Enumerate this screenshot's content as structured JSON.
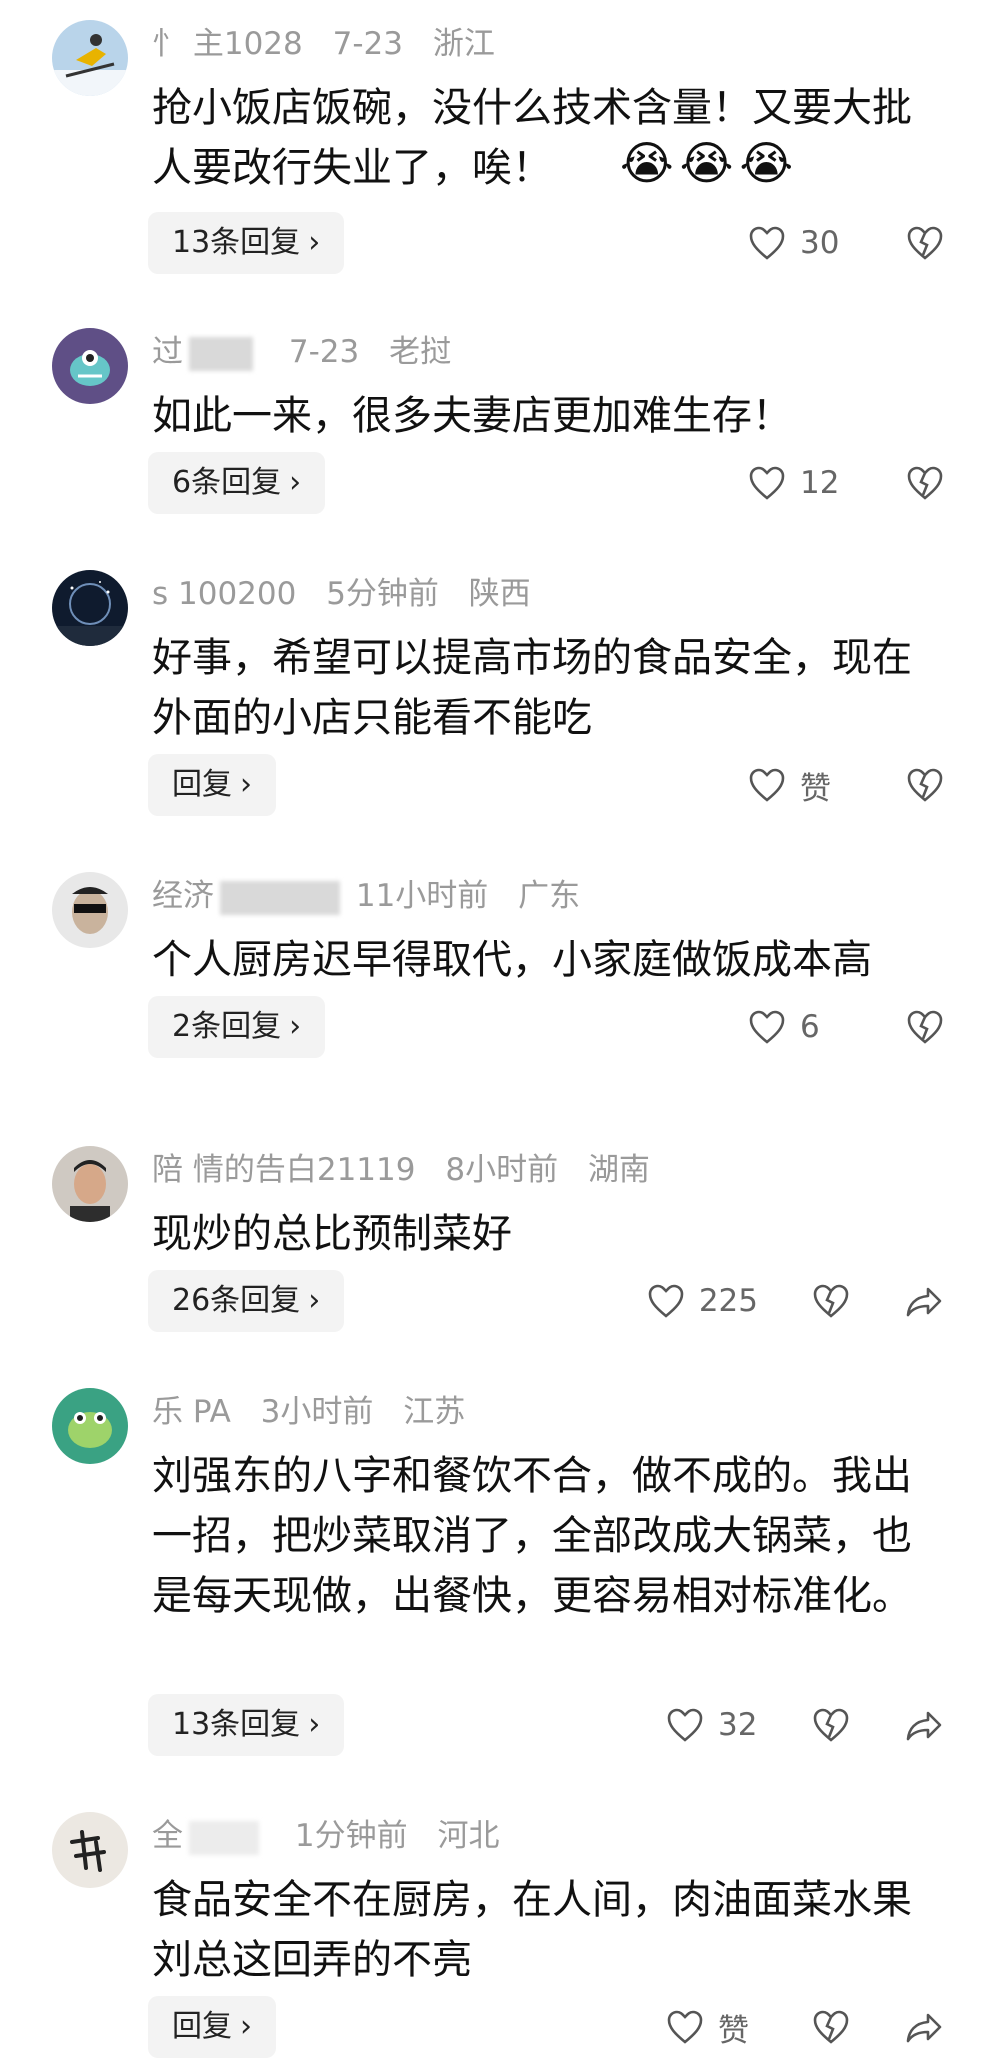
{
  "comments": [
    {
      "user": "忄    主1028",
      "date": "7-23",
      "location": "浙江",
      "text": "抢小饭店饭碗，没什么技术含量！又要大批人要改行失业了，唉！",
      "emoji": [
        "😭",
        "😭",
        "😭"
      ],
      "reply_label": "13条回复",
      "likes": "30",
      "avatar": "skier-avatar"
    },
    {
      "user": "过",
      "date": "7-23",
      "location": "老挝",
      "text": "如此一来，很多夫妻店更加难生存！",
      "reply_label": "6条回复",
      "likes": "12",
      "avatar": "cartoon-avatar"
    },
    {
      "user": "s      100200",
      "date": "5分钟前",
      "location": "陕西",
      "text": "好事，希望可以提高市场的食品安全，现在外面的小店只能看不能吃",
      "reply_label": "回复",
      "likes": "赞",
      "avatar": "night-sky-avatar"
    },
    {
      "user": "经济",
      "date": "11小时前",
      "location": "广东",
      "text": "个人厨房迟早得取代，小家庭做饭成本高",
      "reply_label": "2条回复",
      "likes": "6",
      "avatar": "sunglasses-avatar"
    },
    {
      "user": "陪   情的告白21119",
      "date": "8小时前",
      "location": "湖南",
      "text": "现炒的总比预制菜好",
      "reply_label": "26条回复",
      "likes": "225",
      "avatar": "man-portrait-avatar"
    },
    {
      "user": "乐    PA",
      "date": "3小时前",
      "location": "江苏",
      "text": "刘强东的八字和餐饮不合，做不成的。我出一招，把炒菜取消了，全部改成大锅菜，也是每天现做，出餐快，更容易相对标准化。",
      "reply_label": "13条回复",
      "likes": "32",
      "avatar": "frog-avatar"
    },
    {
      "user": "全",
      "date": "1分钟前",
      "location": "河北",
      "text": "食品安全不在厨房，在人间，肉油面菜水果刘总这回弄的不亮",
      "reply_label": "回复",
      "likes": "赞",
      "avatar": "calligraphy-avatar"
    }
  ],
  "colors": {
    "meta": "#9a9a9a",
    "text": "#111111",
    "reply_bg": "#f3f3f3",
    "icon": "#555555"
  }
}
